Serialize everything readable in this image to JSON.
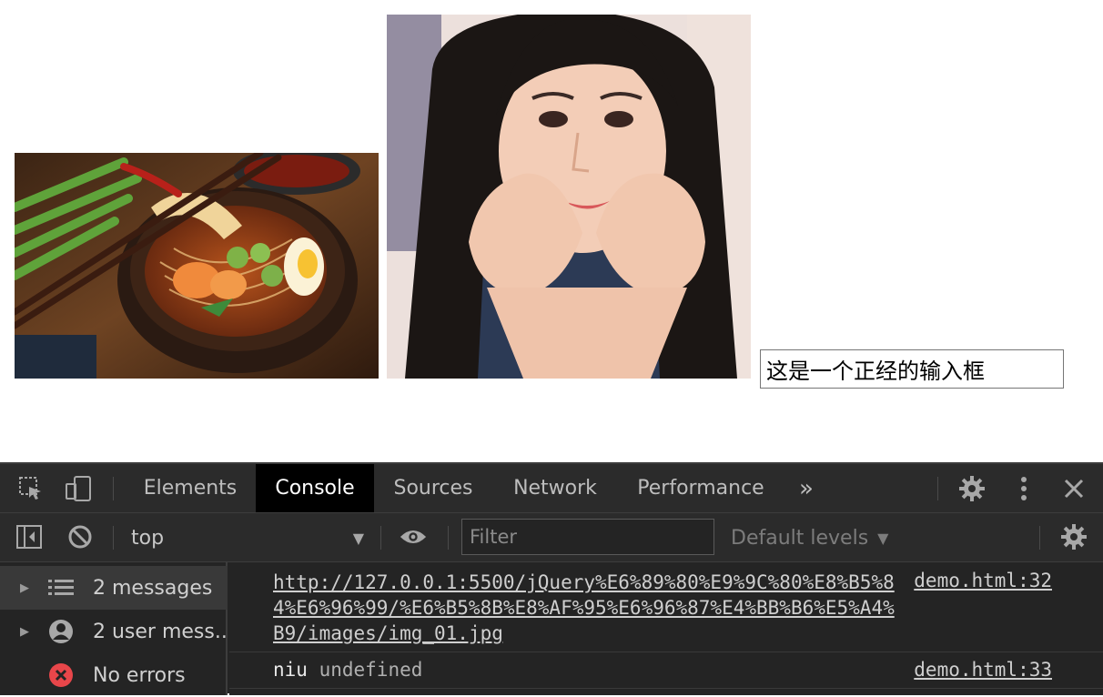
{
  "page": {
    "input_value": "这是一个正经的输入框"
  },
  "devtools": {
    "tabs": [
      {
        "label": "Elements"
      },
      {
        "label": "Console"
      },
      {
        "label": "Sources"
      },
      {
        "label": "Network"
      },
      {
        "label": "Performance"
      }
    ],
    "more_tabs_glyph": "»",
    "active_tab": "Console",
    "toolbar": {
      "context": "top",
      "filter_placeholder": "Filter",
      "levels_label": "Default levels"
    },
    "sidebar": {
      "items": [
        {
          "label": "2 messages"
        },
        {
          "label": "2 user mess..."
        },
        {
          "label": "No errors"
        }
      ]
    },
    "console": {
      "messages": [
        {
          "text": "http://127.0.0.1:5500/jQuery%E6%89%80%E9%9C%80%E8%B5%84%E6%96%99/%E6%B5%8B%E8%AF%95%E6%96%87%E4%BB%B6%E5%A4%B9/images/img_01.jpg",
          "source": "demo.html:32"
        },
        {
          "key": "niu",
          "value": "undefined",
          "source": "demo.html:33"
        }
      ]
    },
    "colors": {
      "panel_bg": "#242424",
      "active_tab_bg": "#000000",
      "error_icon": "#e8464a"
    }
  }
}
